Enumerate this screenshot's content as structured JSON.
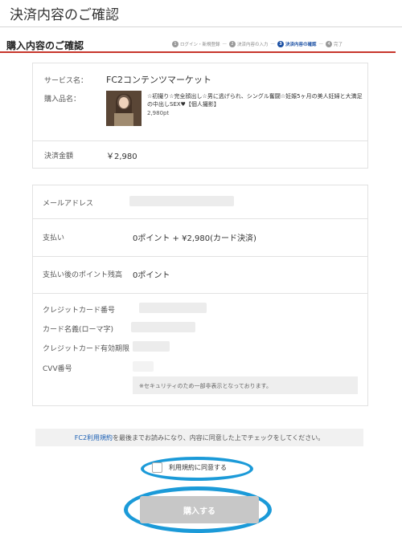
{
  "header": {
    "title": "決済内容のご確認"
  },
  "section": {
    "title": "購入内容のご確認",
    "steps": [
      {
        "num": "1",
        "label": "ログイン・新規登録"
      },
      {
        "num": "2",
        "label": "決済内容の入力"
      },
      {
        "num": "3",
        "label": "決済内容の確認"
      },
      {
        "num": "4",
        "label": "完了"
      }
    ],
    "active_step": 3
  },
  "summary": {
    "service_label": "サービス名：",
    "service_value": "FC2コンテンツマーケット",
    "product_label": "購入品名：",
    "product_title": "☆初撮り☆完全顔出し☆男に逃げられ、シングル奮闘☆妊娠5ヶ月の美人妊婦と大満足の中出しSEX♥【個人撮影】",
    "product_price": "2,980pt",
    "amount_label": "決済金額",
    "amount_value": "￥2,980"
  },
  "payment": {
    "email_label": "メールアドレス",
    "pay_label": "支払い",
    "pay_value": "0ポイント + ¥2,980(カード決済)",
    "points_after_label": "支払い後のポイント残高",
    "points_after_value": "0ポイント",
    "card_number_label": "クレジットカード番号",
    "card_name_label": "カード名義(ローマ字)",
    "card_expiry_label": "クレジットカード有効期限",
    "cvv_label": "CVV番号",
    "security_note": "※セキュリティのため一部非表示となっております。"
  },
  "terms": {
    "link_text": "FC2利用規約",
    "text": "を最後までお読みになり、内容に同意した上でチェックをしてください。",
    "agree_label": "利用規約に同意する"
  },
  "actions": {
    "submit_label": "購入する"
  },
  "colors": {
    "accent_red": "#c7362b",
    "active_step_blue": "#1a4fa3",
    "link_blue": "#1a5fb4",
    "highlight_ring": "#1b9ad8",
    "disabled_button": "#c7c7c7"
  }
}
